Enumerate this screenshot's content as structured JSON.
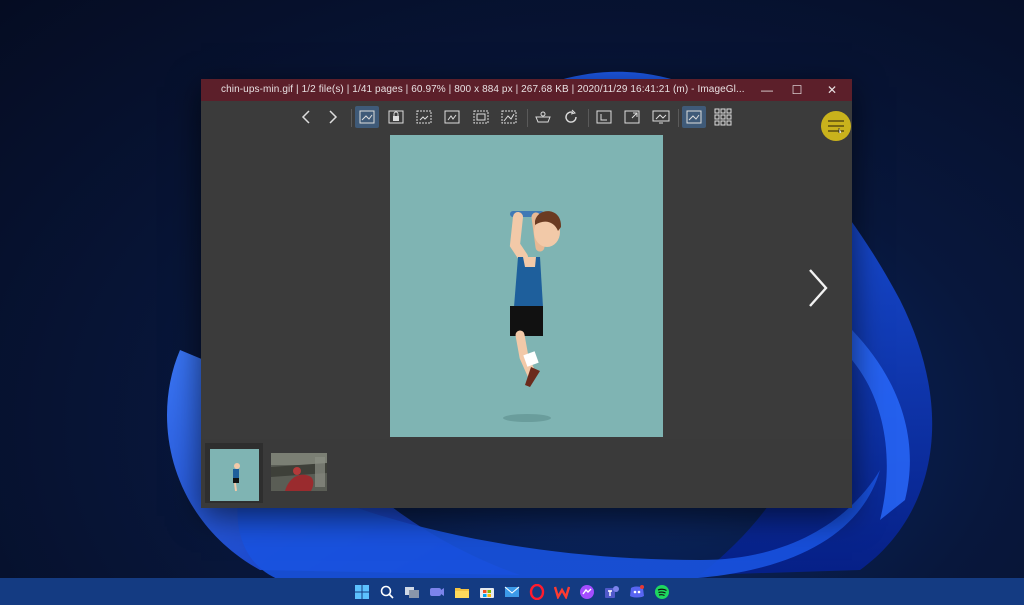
{
  "window": {
    "title": "chin-ups-min.gif  |  1/2 file(s)  |  1/41 pages  |  60.97%  |  800 x 884 px  |  267.68 KB  |  2020/11/29 16:41:21 (m)  - ImageGl...",
    "minimize": "—",
    "maximize": "☐",
    "close": "✕"
  },
  "toolbar": {
    "items": [
      {
        "icon": "previous-icon"
      },
      {
        "icon": "next-icon"
      },
      {
        "icon": "auto-zoom-icon",
        "active": true
      },
      {
        "icon": "lock-zoom-icon"
      },
      {
        "icon": "scale-to-width-icon"
      },
      {
        "icon": "scale-to-height-icon"
      },
      {
        "icon": "scale-to-fit-icon"
      },
      {
        "icon": "scale-to-fill-icon"
      },
      {
        "icon": "checkerboard-icon"
      },
      {
        "icon": "rotate-icon"
      },
      {
        "icon": "frameless-icon"
      },
      {
        "icon": "fullscreen-icon"
      },
      {
        "icon": "slideshow-icon"
      },
      {
        "icon": "thumbnail-bar-icon",
        "active": true
      },
      {
        "icon": "gallery-grid-icon"
      }
    ],
    "menu_icon": "hamburger-menu-icon"
  },
  "viewer": {
    "background": "#7fb4b3",
    "next_icon": "chevron-right-icon"
  },
  "thumbnails": [
    {
      "name": "chin-ups-min.gif",
      "selected": true
    },
    {
      "name": "second-image",
      "selected": false
    }
  ],
  "taskbar": {
    "color": "#143b82",
    "apps": [
      "windows-start-icon",
      "search-icon",
      "task-view-icon",
      "teams-chat-icon",
      "file-explorer-icon",
      "store-icon",
      "mail-icon",
      "opera-icon",
      "wps-office-icon",
      "messenger-icon",
      "teams-icon",
      "discord-icon",
      "spotify-icon"
    ]
  }
}
